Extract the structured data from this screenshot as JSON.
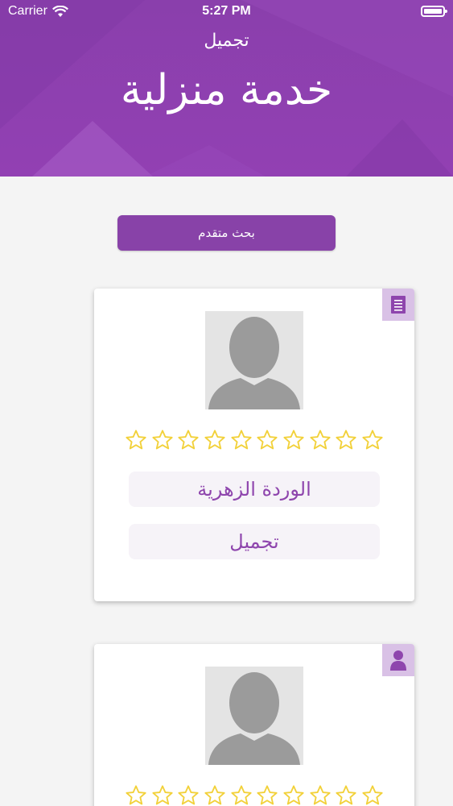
{
  "status_bar": {
    "carrier": "Carrier",
    "time": "5:27 PM"
  },
  "header": {
    "subtitle": "تجميل",
    "title": "خدمة منزلية"
  },
  "search": {
    "label": "بحث متقدم"
  },
  "cards": [
    {
      "corner_icon": "document-icon",
      "rating_stars": 10,
      "name": "الوردة الزهرية",
      "category": "تجميل"
    },
    {
      "corner_icon": "person-icon",
      "rating_stars": 10
    }
  ],
  "colors": {
    "primary": "#8a3fac",
    "star": "#f2d13a",
    "pill_text": "#8e45ad",
    "corner_bg": "#d9c1e6"
  }
}
